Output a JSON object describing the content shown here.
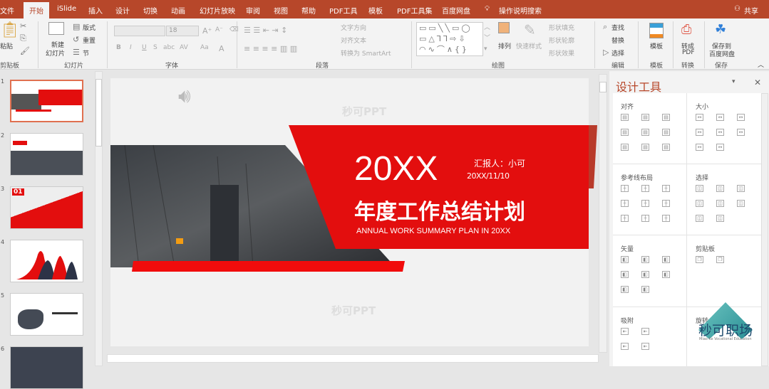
{
  "tabs": [
    "文件",
    "开始",
    "iSlide",
    "插入",
    "设计",
    "切换",
    "动画",
    "幻灯片放映",
    "审阅",
    "视图",
    "帮助",
    "PDF工具",
    "模板",
    "PDF工具集",
    "百度网盘"
  ],
  "search_hint": "操作说明搜索",
  "share": "共享",
  "ribbon": {
    "clipboard": {
      "paste": "粘贴",
      "label": "剪贴板"
    },
    "slides": {
      "new_slide": "新建",
      "new_slide2": "幻灯片",
      "layout": "版式",
      "reset": "重置",
      "section": "节",
      "label": "幻灯片"
    },
    "font": {
      "font_name": "",
      "font_size": "18",
      "label": "字体",
      "bold": "B",
      "italic": "I",
      "underline": "U",
      "strike": "S",
      "abc": "abc",
      "av": "AV",
      "aa": "Aa",
      "a": "A"
    },
    "paragraph": {
      "text_dir": "文字方向",
      "align_text": "对齐文本",
      "smartart": "转换为 SmartArt",
      "label": "段落"
    },
    "drawing": {
      "arrange": "排列",
      "quick_style": "快速样式",
      "fill": "形状填充",
      "outline": "形状轮廓",
      "effect": "形状效果",
      "label": "绘图"
    },
    "editing": {
      "find": "查找",
      "replace": "替换",
      "select": "选择",
      "label": "编辑"
    },
    "template": {
      "btn": "模板",
      "label": "模板"
    },
    "convert": {
      "btn1": "转成",
      "btn2": "PDF",
      "label": "转换"
    },
    "save": {
      "btn1": "保存到",
      "btn2": "百度网盘",
      "label": "保存"
    }
  },
  "thumbnails": [
    {
      "num": "1"
    },
    {
      "num": "2"
    },
    {
      "num": "3",
      "badge": "01"
    },
    {
      "num": "4"
    },
    {
      "num": "5"
    },
    {
      "num": "6"
    }
  ],
  "slide": {
    "watermark": "秒可PPT",
    "year": "20XX",
    "reporter": "汇报人：小可",
    "date": "20XX/11/10",
    "title": "年度工作总结计划",
    "subtitle": "ANNUAL WORK SUMMARY PLAN IN 20XX"
  },
  "panel": {
    "title": "设计工具",
    "sections": {
      "align": "对齐",
      "size": "大小",
      "guides": "参考线布局",
      "select": "选择",
      "vector": "矢量",
      "clipboard": "剪贴板",
      "snap": "吸附",
      "rotate": "旋转"
    }
  },
  "logo": {
    "name": "秒可职场",
    "tagline": "Miao Ke Vocational Education"
  },
  "colors": {
    "accent": "#b7472a",
    "slide_red": "#e30e0e"
  }
}
